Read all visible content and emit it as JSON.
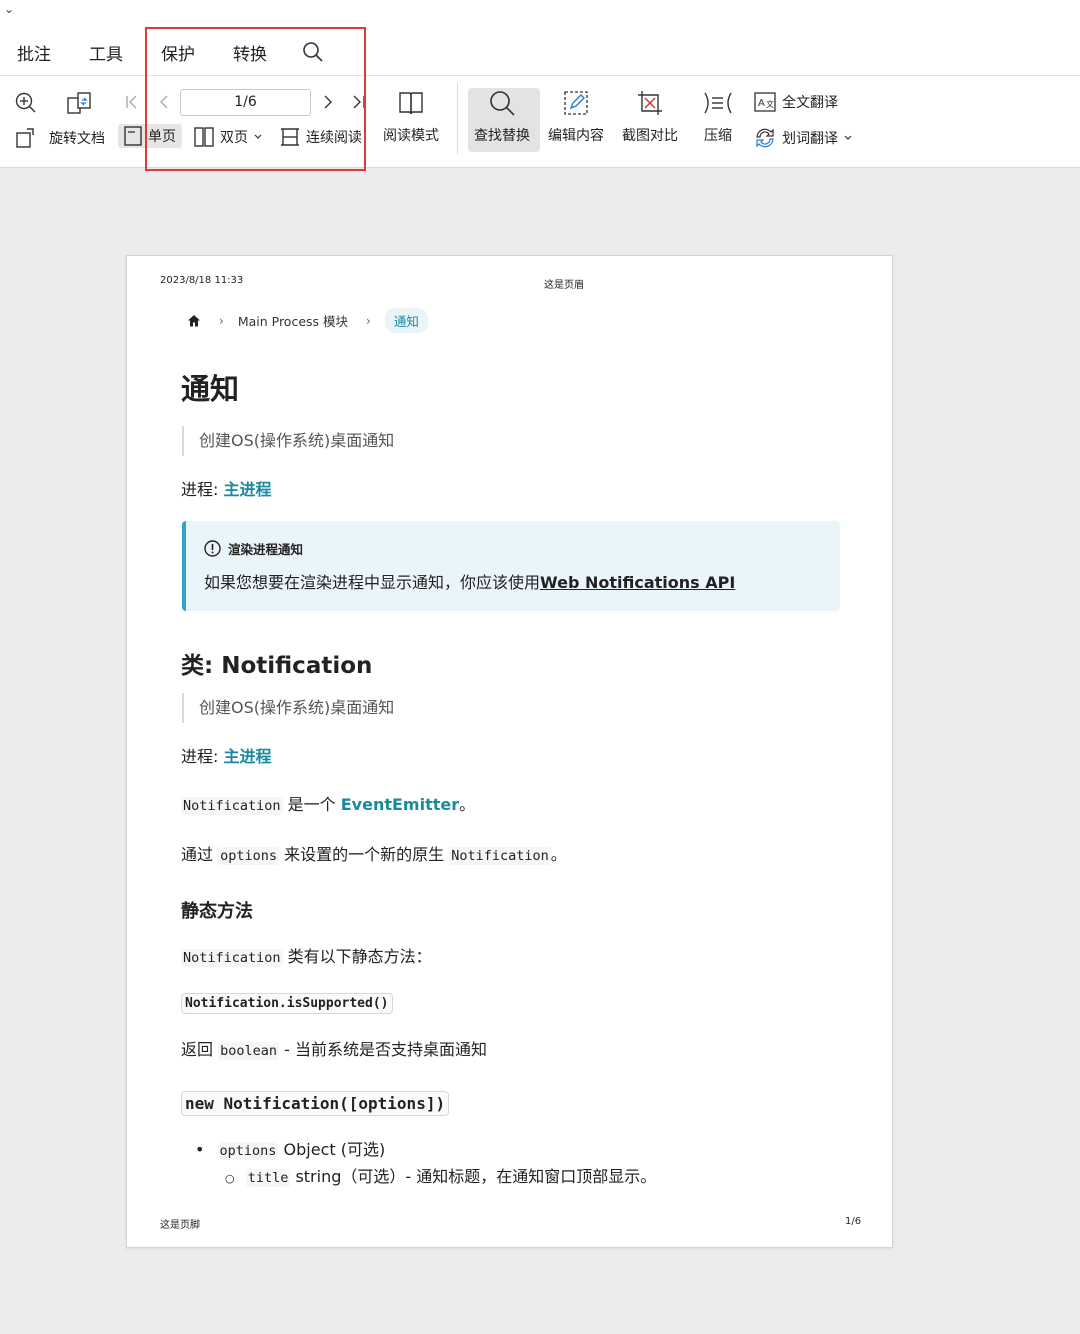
{
  "menu": {
    "collapse_glyph": "⌄",
    "tabs": [
      "批注",
      "工具",
      "保护",
      "转换"
    ]
  },
  "toolbar": {
    "rotate_doc": "旋转文档",
    "single_page": "单页",
    "double_page": "双页",
    "continuous_read": "连续阅读",
    "page_indicator": "1/6",
    "reading_mode": "阅读模式",
    "find_replace": "查找替换",
    "edit_content": "编辑内容",
    "screenshot_compare": "截图对比",
    "compress": "压缩",
    "full_translate": "全文翻译",
    "word_translate": "划词翻译"
  },
  "page": {
    "header_date": "2023/8/18 11:33",
    "header_title": "这是页眉",
    "breadcrumb": {
      "section": "Main Process 模块",
      "current": "通知"
    },
    "title": "通知",
    "quote1": "创建OS(操作系统)桌面通知",
    "process_label": "进程:",
    "process_link": "主进程",
    "callout": {
      "title": "渲染进程通知",
      "text": "如果您想要在渲染进程中显示通知，你应该使用",
      "link": "Web Notifications API"
    },
    "class_title": "类: Notification",
    "quote2": "创建OS(操作系统)桌面通知",
    "process_label2": "进程:",
    "process_link2": "主进程",
    "emitter": {
      "code": "Notification",
      "text": "是一个",
      "link": "EventEmitter",
      "end": "。"
    },
    "options_line": {
      "pre": "通过",
      "code1": "options",
      "mid": "来设置的一个新的原生",
      "code2": "Notification",
      "end": "。"
    },
    "static_methods": "静态方法",
    "static_line": {
      "code": "Notification",
      "text": "类有以下静态方法："
    },
    "is_supported": "Notification.isSupported()",
    "returns_line": {
      "pre": "返回",
      "code": "boolean",
      "text": "- 当前系统是否支持桌面通知"
    },
    "constructor": "new Notification([options])",
    "bullet1": {
      "code": "options",
      "text": "Object (可选)"
    },
    "bullet2": {
      "code": "title",
      "text": "string（可选）- 通知标题，在通知窗口顶部显示。"
    },
    "footer_left": "这是页脚",
    "footer_right": "1/6"
  },
  "colors": {
    "accent_link": "#1a8aa0",
    "highlight_border": "#e0393b",
    "callout_bg": "#eaf5fb",
    "callout_bar": "#2ea6c4"
  }
}
